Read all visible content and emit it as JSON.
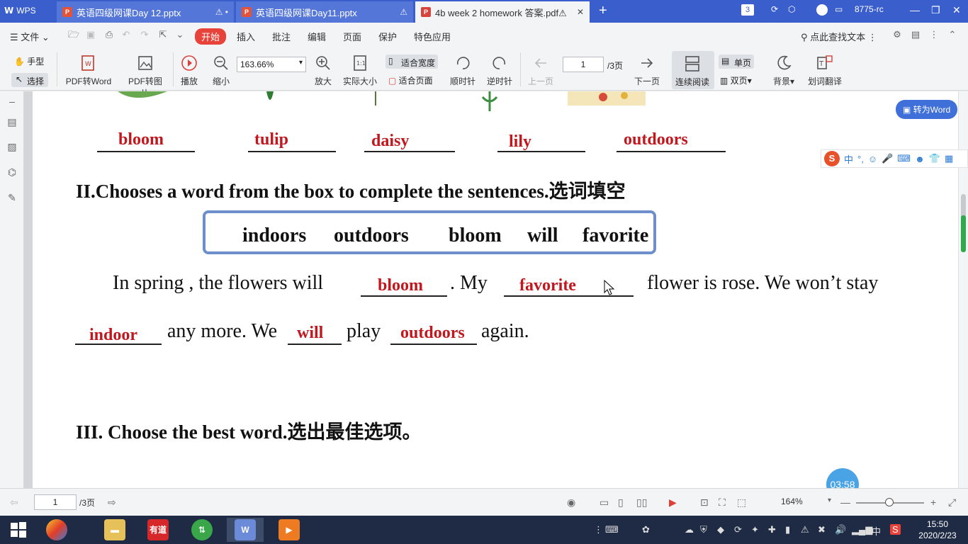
{
  "titlebar": {
    "app_name": "WPS",
    "tabs": [
      {
        "label": "英语四级网课Day 12.pptx",
        "icon": "P",
        "tail": "⚠ •"
      },
      {
        "label": "英语四级网课Day11.pptx",
        "icon": "P",
        "tail": "⚠"
      },
      {
        "label": "4b week 2 homework 答案.pdf⚠",
        "icon": "P",
        "tail": "✕"
      }
    ],
    "new_tab": "+",
    "window_count": "3",
    "user_id": "8775-rc"
  },
  "menubar": {
    "file": "文件",
    "start": "开始",
    "items": [
      "插入",
      "批注",
      "编辑",
      "页面",
      "保护",
      "特色应用"
    ],
    "search": "点此查找文本"
  },
  "toolbar": {
    "hand": "手型",
    "select": "选择",
    "pdf_to_word": "PDF转Word",
    "pdf_to_image": "PDF转图片",
    "play": "播放",
    "zoom_out": "缩小",
    "zoom_value": "163.66%",
    "zoom_in": "放大",
    "actual_size": "实际大小",
    "fit_width": "适合宽度",
    "fit_page": "适合页面",
    "rotate_cw": "顺时针",
    "rotate_ccw": "逆时针",
    "prev_page": "上一页",
    "page_value": "1",
    "page_total": "/3页",
    "next_page": "下一页",
    "continuous": "连续阅读",
    "single": "单页",
    "double": "双页",
    "background": "背景",
    "translate": "划词翻译"
  },
  "document": {
    "answers_row": [
      "bloom",
      "tulip",
      "daisy",
      "lily",
      "outdoors"
    ],
    "section2_title": "II.Chooses a word from the box to complete the sentences.选词填空",
    "box_words": [
      "indoors",
      "outdoors",
      "bloom",
      "will",
      "favorite"
    ],
    "line1_part1": "In spring , the flowers will",
    "line1_ans1": "bloom",
    "line1_part2": ". My",
    "line1_ans2": "favorite",
    "line1_part3": "flower is rose. We won’t stay",
    "line2_ans1": "indoor",
    "line2_part1": "any more. We",
    "line2_ans2": "will",
    "line2_part2": "play",
    "line2_ans3": "outdoors",
    "line2_part3": "again.",
    "section3_title": "III. Choose the best word.选出最佳选项。"
  },
  "floating": {
    "to_word": "转为Word",
    "timer": "03:58",
    "ime": "中"
  },
  "statusbar": {
    "page_value": "1",
    "page_total": "/3页",
    "zoom": "164%"
  },
  "taskbar": {
    "youdao": "有道",
    "time": "15:50",
    "date": "2020/2/23",
    "ime": "中"
  }
}
